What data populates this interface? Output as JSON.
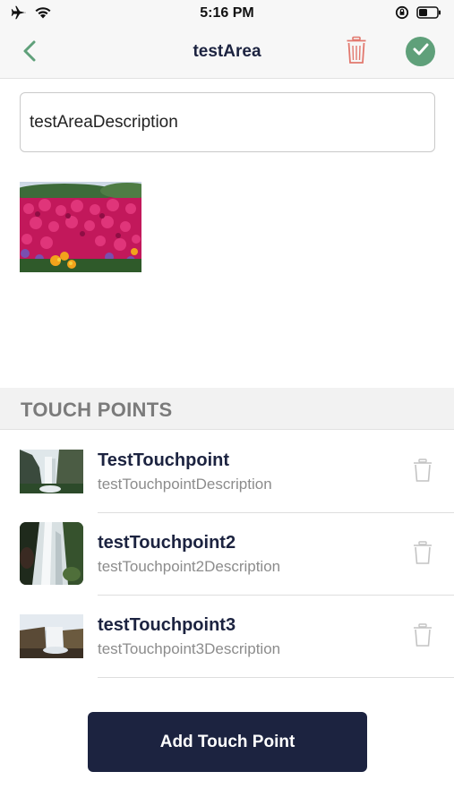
{
  "status_bar": {
    "time": "5:16 PM",
    "icons_left": [
      "airplane-icon",
      "wifi-icon"
    ],
    "icons_right": [
      "orientation-lock-icon",
      "battery-icon"
    ]
  },
  "nav": {
    "title": "testArea",
    "back_icon": "chevron-left-icon",
    "delete_icon": "trash-icon",
    "confirm_icon": "check-circle-icon"
  },
  "form": {
    "description_value": "testAreaDescription"
  },
  "area_image": {
    "subject": "flower-garden-photo"
  },
  "touch_points": {
    "section_title": "TOUCH POINTS",
    "items": [
      {
        "name": "TestTouchpoint",
        "description": "testTouchpointDescription",
        "thumb": "waterfall-cliff-photo"
      },
      {
        "name": "testTouchpoint2",
        "description": "testTouchpoint2Description",
        "thumb": "waterfall-rocks-photo"
      },
      {
        "name": "testTouchpoint3",
        "description": "testTouchpoint3Description",
        "thumb": "waterfall-canyon-photo"
      }
    ]
  },
  "actions": {
    "add_touch_point_label": "Add Touch Point"
  },
  "colors": {
    "accent_green": "#5fa07a",
    "delete_red": "#e2786e",
    "navy": "#1c2340",
    "muted_text": "#8c8c8c",
    "section_bg": "#f2f2f2"
  }
}
